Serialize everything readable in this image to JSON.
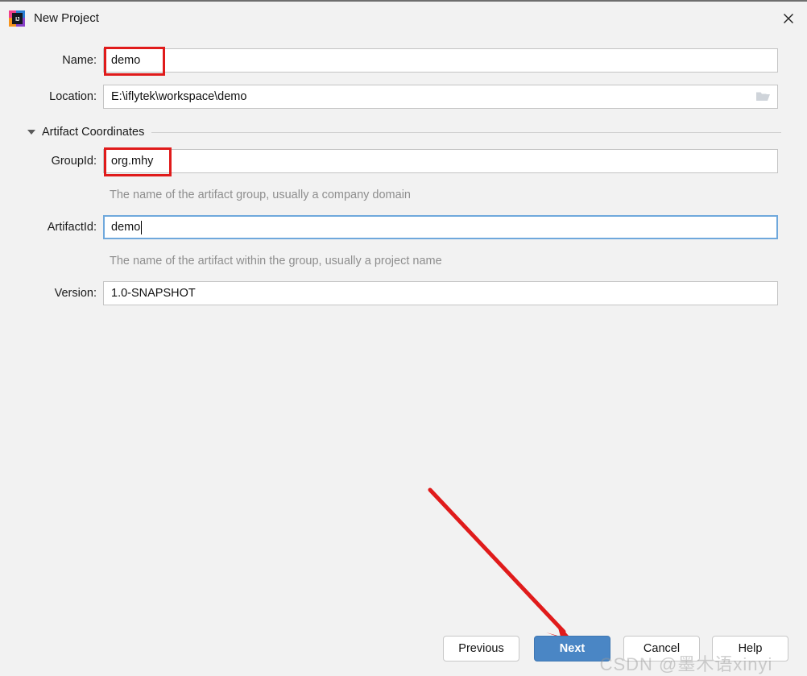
{
  "window": {
    "title": "New Project",
    "app_icon": "intellij-idea-icon",
    "icon_text": "IJ",
    "close_icon": "close-icon"
  },
  "form": {
    "name": {
      "label": "Name:",
      "value": "demo",
      "highlighted": true
    },
    "location": {
      "label": "Location:",
      "value": "E:\\iflytek\\workspace\\demo",
      "browse_icon": "folder-icon"
    },
    "section": {
      "title": "Artifact Coordinates",
      "expanded": true,
      "collapse_icon": "chevron-down-icon"
    },
    "group_id": {
      "label": "GroupId:",
      "value": "org.mhy",
      "hint": "The name of the artifact group, usually a company domain",
      "highlighted": true
    },
    "artifact_id": {
      "label": "ArtifactId:",
      "value": "demo",
      "hint": "The name of the artifact within the group, usually a project name",
      "focused": true
    },
    "version": {
      "label": "Version:",
      "value": "1.0-SNAPSHOT"
    }
  },
  "buttons": {
    "previous": "Previous",
    "next": "Next",
    "cancel": "Cancel",
    "help": "Help"
  },
  "annotations": {
    "arrow_color": "#e01b1b",
    "box_color": "#e01b1b",
    "arrow_target": "next-button"
  },
  "watermark": {
    "text": "CSDN @墨木语xinyi"
  },
  "colors": {
    "background": "#f2f2f2",
    "field_background": "#ffffff",
    "field_border": "#c4c4c4",
    "focus_border": "#6fa8dc",
    "primary_button": "#4a86c5",
    "hint_text": "#8e8e8e",
    "annotation_red": "#e01b1b"
  }
}
